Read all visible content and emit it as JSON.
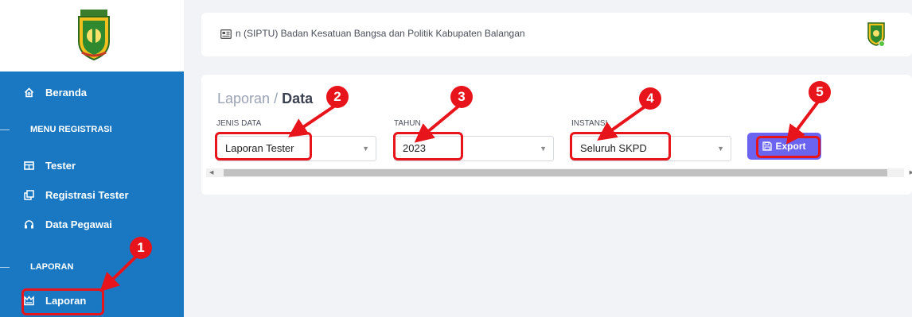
{
  "sidebar": {
    "menu": {
      "beranda": "Beranda",
      "section_registrasi": "MENU REGISTRASI",
      "tester": "Tester",
      "registrasi_tester": "Registrasi Tester",
      "data_pegawai": "Data Pegawai",
      "section_laporan": "LAPORAN",
      "laporan": "Laporan"
    }
  },
  "header": {
    "title": "n (SIPTU) Badan Kesatuan Bangsa dan Politik Kabupaten Balangan"
  },
  "page": {
    "breadcrumb_parent": "Laporan",
    "breadcrumb_sep": " / ",
    "breadcrumb_current": "Data",
    "filters": {
      "jenis_data": {
        "label": "JENIS DATA",
        "value": "Laporan Tester"
      },
      "tahun": {
        "label": "TAHUN",
        "value": "2023"
      },
      "instansi": {
        "label": "INSTANSI",
        "value": "Seluruh SKPD"
      }
    },
    "export_label": "Export"
  },
  "annotations": {
    "badges": [
      "1",
      "2",
      "3",
      "4",
      "5"
    ],
    "color": "#e8141b"
  },
  "colors": {
    "sidebar": "#1a78c2",
    "export_button": "#6a64f1",
    "background": "#f2f3f7"
  },
  "icons": {
    "beranda": "home-icon",
    "tester": "table-icon",
    "registrasi_tester": "copy-icon",
    "data_pegawai": "headset-icon",
    "laporan": "report-icon",
    "header": "document-icon",
    "export": "save-icon"
  }
}
